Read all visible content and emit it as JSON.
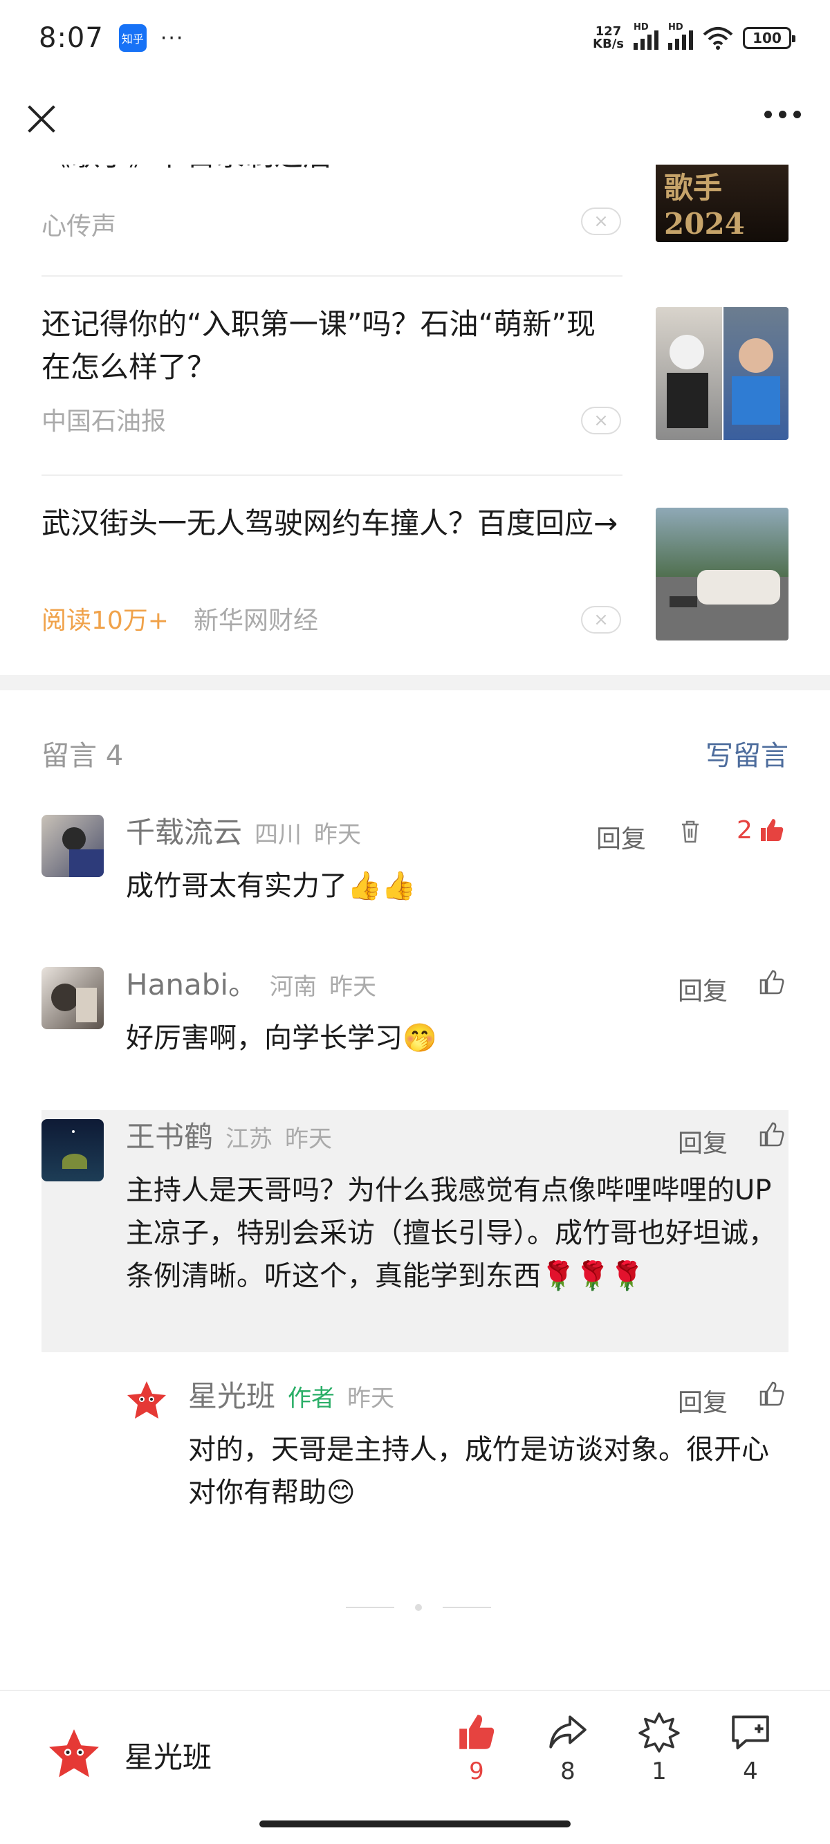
{
  "status_bar": {
    "time": "8:07",
    "app_badge": "知乎",
    "dots": "···",
    "net_speed_value": "127",
    "net_speed_unit": "KB/s",
    "signal1_tag": "HD",
    "signal2_tag": "HD",
    "battery": "100"
  },
  "news": [
    {
      "title": "《歌手》节目录制之后",
      "source": "心传声",
      "hot": "",
      "thumb": "歌手2024"
    },
    {
      "title": "还记得你的“入职第一课”吗？石油“萌新”现在怎么样了？",
      "source": "中国石油报",
      "hot": "",
      "thumb": ""
    },
    {
      "title": "武汉街头一无人驾驶网约车撞人？百度回应→",
      "source": "新华网财经",
      "hot": "阅读10万+",
      "thumb": ""
    }
  ],
  "close_glyph": "×",
  "comments_section": {
    "title": "留言 4",
    "write_label": "写留言"
  },
  "comments": [
    {
      "user": "千载流云",
      "location": "四川",
      "time": "昨天",
      "reply": "回复",
      "likes": "2",
      "text": "成竹哥太有实力了👍👍"
    },
    {
      "user": "Hanabi。",
      "location": "河南",
      "time": "昨天",
      "reply": "回复",
      "likes": "",
      "text": "好厉害啊，向学长学习🤭"
    },
    {
      "user": "王书鹤",
      "location": "江苏",
      "time": "昨天",
      "reply": "回复",
      "likes": "",
      "text": "主持人是天哥吗？为什么我感觉有点像哔哩哔哩的UP主凉子，特别会采访（擅长引导）。成竹哥也好坦诚，条例清晰。听这个，真能学到东西🌹🌹🌹"
    },
    {
      "user": "星光班",
      "badge": "作者",
      "time": "昨天",
      "reply": "回复",
      "likes": "",
      "text": "对的，天哥是主持人，成竹是访谈对象。很开心对你有帮助😊"
    }
  ],
  "bottom_bar": {
    "author": "星光班",
    "like_count": "9",
    "share_count": "8",
    "star_count": "1",
    "comment_count": "4"
  },
  "colors": {
    "accent_red": "#e64340",
    "link_blue": "#4e6d9d",
    "author_green": "#2aae67",
    "hot_orange": "#f0a24a"
  }
}
